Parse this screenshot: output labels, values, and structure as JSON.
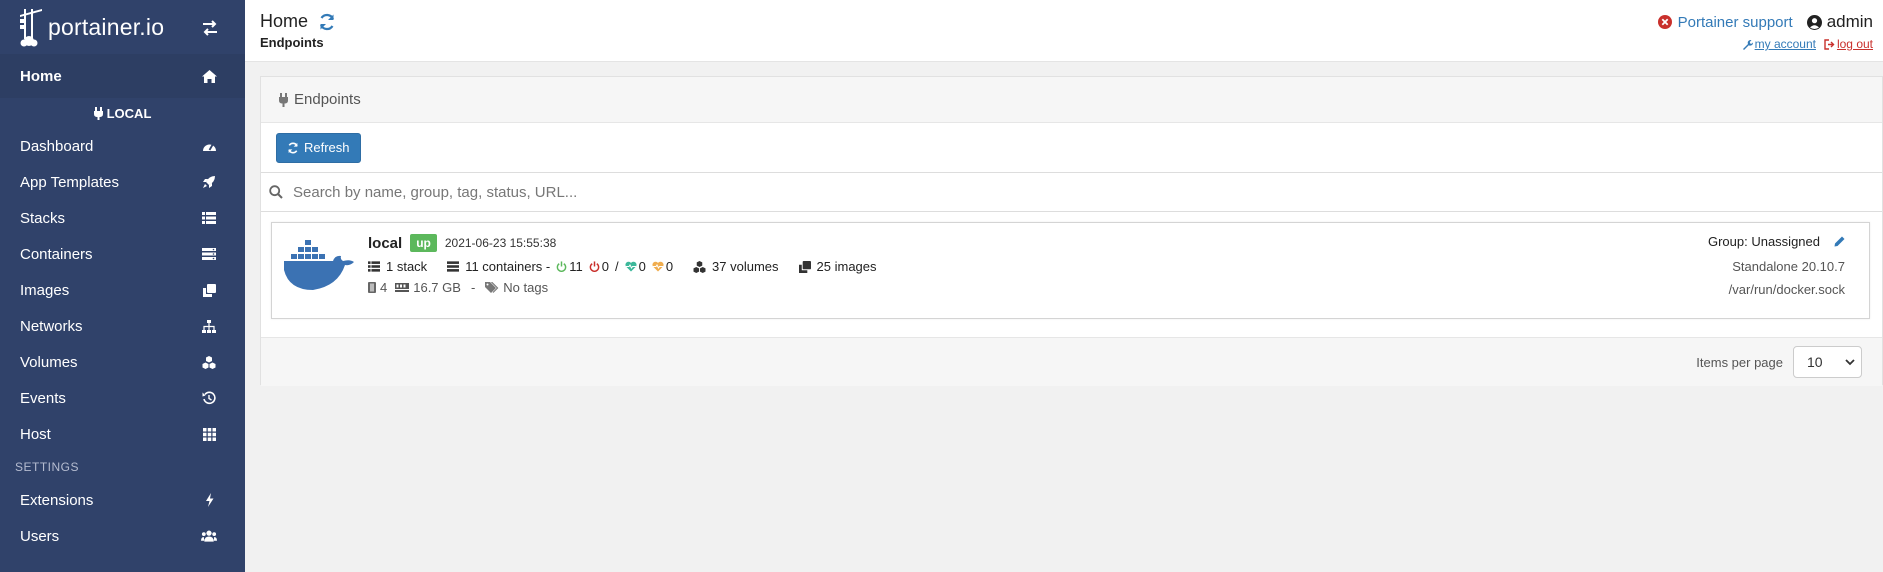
{
  "brand": {
    "name": "portainer.io"
  },
  "sidebar": {
    "home_label": "Home",
    "endpoint_label": "LOCAL",
    "items": [
      {
        "label": "Dashboard",
        "icon": "dashboard-icon"
      },
      {
        "label": "App Templates",
        "icon": "rocket-icon"
      },
      {
        "label": "Stacks",
        "icon": "list-icon"
      },
      {
        "label": "Containers",
        "icon": "server-icon"
      },
      {
        "label": "Images",
        "icon": "clone-icon"
      },
      {
        "label": "Networks",
        "icon": "sitemap-icon"
      },
      {
        "label": "Volumes",
        "icon": "cubes-icon"
      },
      {
        "label": "Events",
        "icon": "history-icon"
      },
      {
        "label": "Host",
        "icon": "grid-icon"
      }
    ],
    "settings_label": "SETTINGS",
    "settings_items": [
      {
        "label": "Extensions",
        "icon": "bolt-icon"
      },
      {
        "label": "Users",
        "icon": "users-icon"
      }
    ]
  },
  "header": {
    "title": "Home",
    "subtitle": "Endpoints",
    "support": "Portainer support",
    "user": "admin",
    "my_account": "my account",
    "log_out": "log out"
  },
  "widget": {
    "title": "Endpoints",
    "refresh_label": "Refresh",
    "search_placeholder": "Search by name, group, tag, status, URL...",
    "items_per_page_label": "Items per page",
    "items_per_page_value": "10"
  },
  "endpoint": {
    "name": "local",
    "status": "up",
    "date": "2021-06-23 15:55:38",
    "stacks": "1 stack",
    "containers": "11 containers -",
    "running": "11",
    "stopped": "0",
    "separator": "/",
    "healthy": "0",
    "unhealthy": "0",
    "volumes": "37 volumes",
    "images": "25 images",
    "cpu": "4",
    "memory": "16.7 GB",
    "dash": "-",
    "tags": "No tags",
    "group": "Group: Unassigned",
    "type": "Standalone 20.10.7",
    "url": "/var/run/docker.sock"
  },
  "colors": {
    "sidebar_bg": "#30426a",
    "accent": "#337ab7",
    "status_up": "#5cb85c",
    "danger": "#c9302c"
  }
}
